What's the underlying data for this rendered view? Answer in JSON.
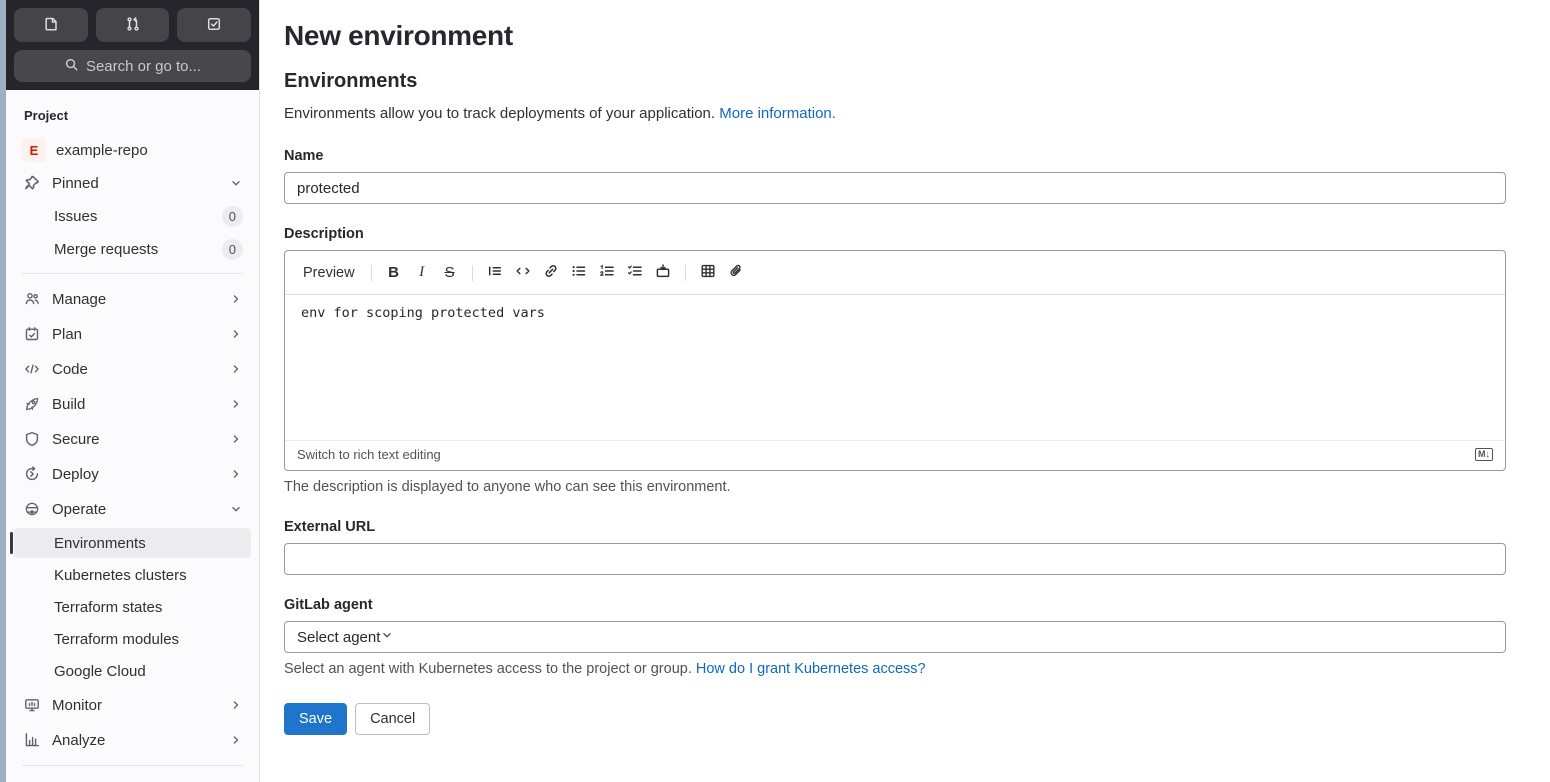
{
  "topbar": {
    "search_label": "Search or go to..."
  },
  "sidebar": {
    "section_label": "Project",
    "project": {
      "avatar_letter": "E",
      "name": "example-repo"
    },
    "pinned": {
      "label": "Pinned",
      "items": [
        {
          "label": "Issues",
          "count": "0"
        },
        {
          "label": "Merge requests",
          "count": "0"
        }
      ]
    },
    "nav": [
      {
        "label": "Manage",
        "icon": "users-icon"
      },
      {
        "label": "Plan",
        "icon": "calendar-icon"
      },
      {
        "label": "Code",
        "icon": "code-icon"
      },
      {
        "label": "Build",
        "icon": "rocket-icon"
      },
      {
        "label": "Secure",
        "icon": "shield-icon"
      },
      {
        "label": "Deploy",
        "icon": "deploy-icon"
      },
      {
        "label": "Operate",
        "icon": "operate-icon"
      }
    ],
    "operate_children": [
      "Environments",
      "Kubernetes clusters",
      "Terraform states",
      "Terraform modules",
      "Google Cloud"
    ],
    "active_item": "Environments",
    "nav_after": [
      {
        "label": "Monitor",
        "icon": "monitor-icon"
      },
      {
        "label": "Analyze",
        "icon": "analyze-icon"
      }
    ]
  },
  "main": {
    "title": "New environment",
    "section_heading": "Environments",
    "intro_text": "Environments allow you to track deployments of your application.",
    "intro_link": "More information.",
    "name_field": {
      "label": "Name",
      "value": "protected"
    },
    "description": {
      "label": "Description",
      "preview_label": "Preview",
      "toolbar_icons": [
        "bold-icon",
        "italic-icon",
        "strikethrough-icon",
        "quote-icon",
        "code-icon",
        "link-icon",
        "bullet-list-icon",
        "numbered-list-icon",
        "task-list-icon",
        "collapsible-section-icon",
        "table-icon",
        "attach-file-icon"
      ],
      "value": "env for scoping protected vars",
      "switch_label": "Switch to rich text editing",
      "markdown_badge": "M↓",
      "help_text": "The description is displayed to anyone who can see this environment."
    },
    "external_url": {
      "label": "External URL",
      "value": ""
    },
    "gitlab_agent": {
      "label": "GitLab agent",
      "selected": "Select agent",
      "help_text": "Select an agent with Kubernetes access to the project or group.",
      "help_link": "How do I grant Kubernetes access?"
    },
    "actions": {
      "save": "Save",
      "cancel": "Cancel"
    }
  },
  "colors": {
    "accent_blue": "#1f75cb",
    "link_blue": "#1068bf",
    "topbar_bg": "#26252b",
    "sidebar_bg": "#fbfafd",
    "active_bg": "#ececef",
    "avatar_bg": "#fdf1ee",
    "avatar_text": "#c91c00"
  }
}
